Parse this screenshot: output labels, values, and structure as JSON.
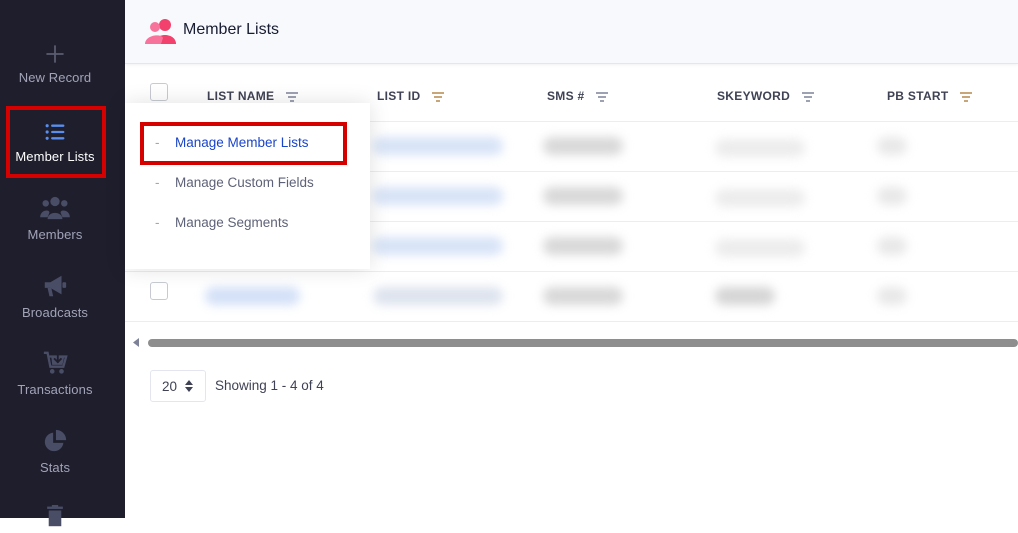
{
  "sidebar": {
    "items": [
      {
        "label": "New Record",
        "icon": "plus-icon"
      },
      {
        "label": "Member Lists",
        "icon": "list-icon"
      },
      {
        "label": "Members",
        "icon": "users-icon"
      },
      {
        "label": "Broadcasts",
        "icon": "megaphone-icon"
      },
      {
        "label": "Transactions",
        "icon": "cart-icon"
      },
      {
        "label": "Stats",
        "icon": "pie-chart-icon"
      }
    ]
  },
  "header": {
    "title": "Member Lists",
    "icon": "user-group-icon"
  },
  "table": {
    "columns": [
      "LIST NAME",
      "LIST ID",
      "SMS #",
      "SKEYWORD",
      "PB START"
    ]
  },
  "dropdown": {
    "items": [
      "Manage Member Lists",
      "Manage Custom Fields",
      "Manage Segments"
    ],
    "dash": "-"
  },
  "pagination": {
    "page_size": "20",
    "showing": "Showing 1 - 4 of 4"
  },
  "colors": {
    "sidebar_bg": "#1e1e2d",
    "accent_pink": "#f1416c",
    "highlight_red": "#d50000",
    "link_blue": "#1a45c8"
  }
}
